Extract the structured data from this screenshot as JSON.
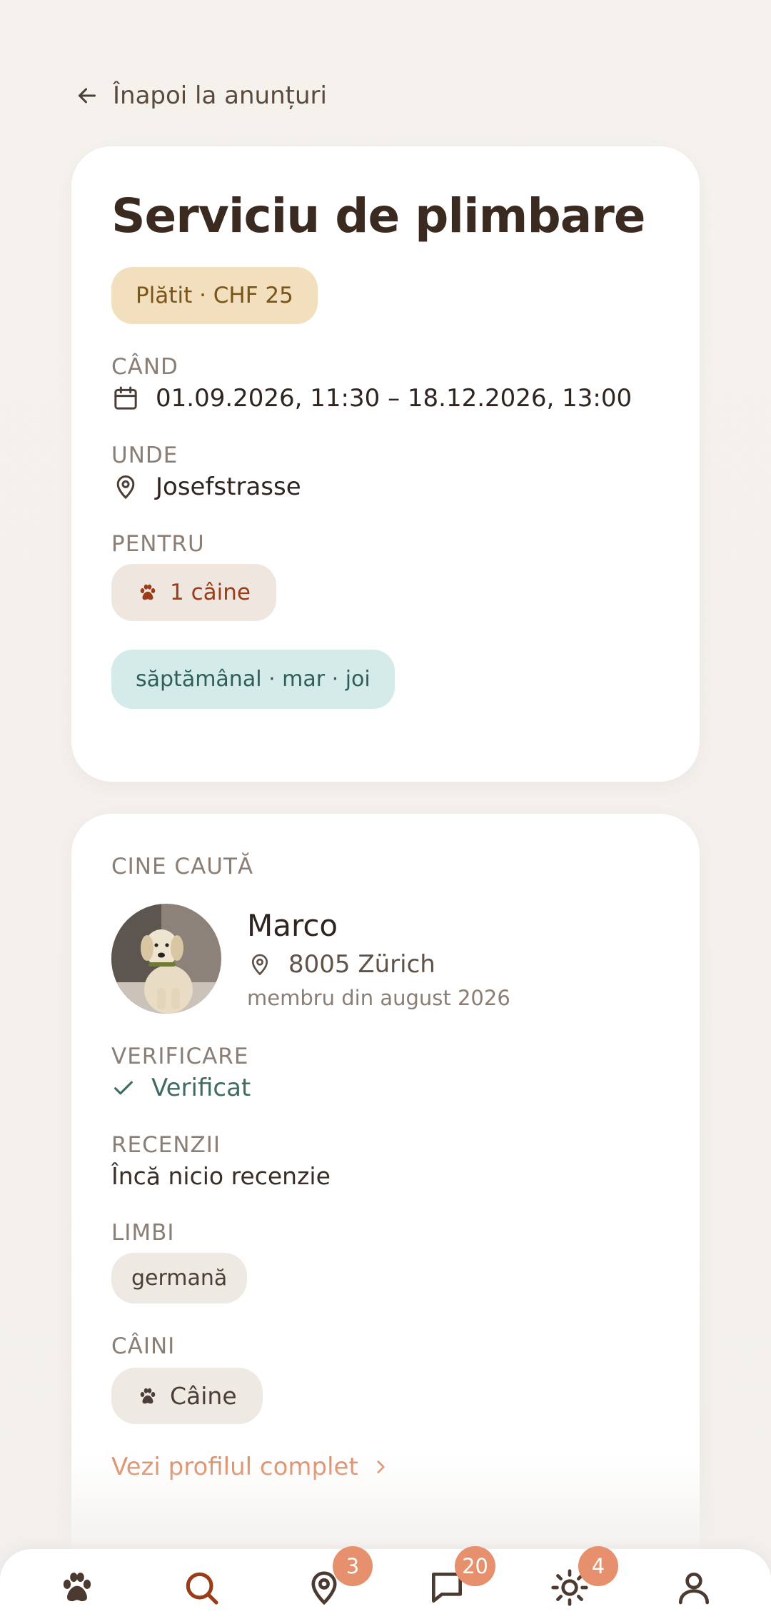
{
  "back_link": {
    "label": "Înapoi la anunțuri"
  },
  "listing": {
    "title": "Serviciu de plimbare",
    "price_tag": "Plătit · CHF 25",
    "when": {
      "label": "CÂND",
      "value": "01.09.2026, 11:30 – 18.12.2026, 13:00"
    },
    "where": {
      "label": "UNDE",
      "value": "Josefstrasse"
    },
    "for": {
      "label": "PENTRU",
      "value": "1 câine"
    },
    "schedule": "săptămânal · mar · joi"
  },
  "owner": {
    "section_label": "CINE CAUTĂ",
    "name": "Marco",
    "location": "8005 Zürich",
    "member_since": "membru din august 2026",
    "verification": {
      "label": "VERIFICARE",
      "value": "Verificat"
    },
    "reviews": {
      "label": "RECENZII",
      "value": "Încă nicio recenzie"
    },
    "languages": {
      "label": "LIMBI",
      "items": [
        "germană"
      ]
    },
    "dogs": {
      "label": "CÂINI",
      "items": [
        "Câine"
      ]
    },
    "profile_link": "Vezi profilul complet"
  },
  "nav": {
    "items": [
      {
        "icon": "paw-icon"
      },
      {
        "icon": "search-icon"
      },
      {
        "icon": "map-pin-icon",
        "badge": "3"
      },
      {
        "icon": "chat-icon",
        "badge": "20"
      },
      {
        "icon": "sun-icon",
        "badge": "4"
      },
      {
        "icon": "user-icon"
      }
    ]
  },
  "colors": {
    "accent": "#dd8f68",
    "badge": "#e6906d",
    "price_pill": "#f2dfbd",
    "schedule_pill": "#d5ebe9",
    "verified": "#3f6b62"
  }
}
